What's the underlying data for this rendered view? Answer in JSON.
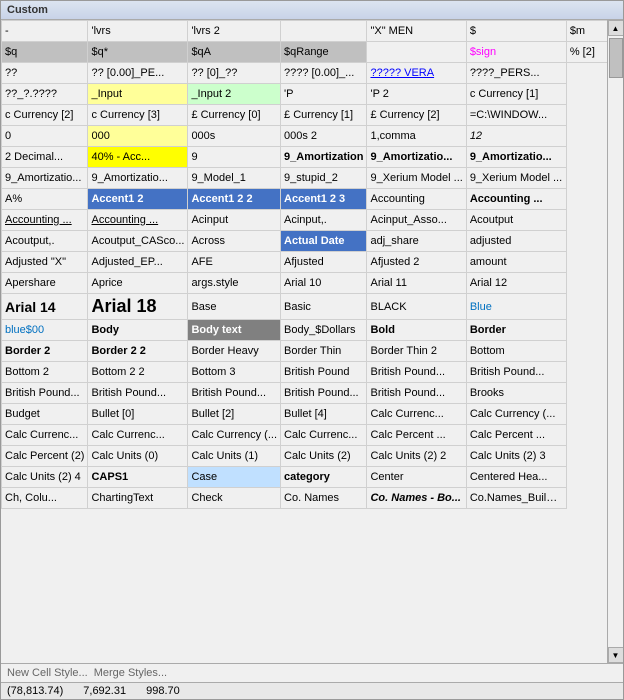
{
  "window": {
    "title": "Custom"
  },
  "buttons": {
    "new_cell_style": "New Cell Style...",
    "merge_styles": "Merge Styles..."
  },
  "status": {
    "val1": "(78,813.74)",
    "val2": "7,692.31",
    "val3": "998.70"
  },
  "grid_rows": [
    [
      {
        "text": "-",
        "style": ""
      },
      {
        "text": "'lvrs",
        "style": ""
      },
      {
        "text": "'lvrs 2",
        "style": ""
      },
      {
        "text": "",
        "style": ""
      },
      {
        "text": "\"X\" MEN",
        "style": ""
      },
      {
        "text": "$",
        "style": ""
      },
      {
        "text": "$m",
        "style": ""
      }
    ],
    [
      {
        "text": "$q",
        "style": "cell-gray"
      },
      {
        "text": "$q*",
        "style": "cell-gray"
      },
      {
        "text": "$qA",
        "style": "cell-gray"
      },
      {
        "text": "$qRange",
        "style": "cell-gray"
      },
      {
        "text": "",
        "style": ""
      },
      {
        "text": "$sign",
        "style": "cell-pink-text"
      },
      {
        "text": "% [2]",
        "style": ""
      }
    ],
    [
      {
        "text": "??",
        "style": ""
      },
      {
        "text": "?? [0.00]_PE...",
        "style": ""
      },
      {
        "text": "?? [0]_??",
        "style": ""
      },
      {
        "text": "???? [0.00]_...",
        "style": ""
      },
      {
        "text": "????? VERA",
        "style": "cell-vera"
      },
      {
        "text": "????_PERS...",
        "style": ""
      }
    ],
    [
      {
        "text": "??_?.????",
        "style": ""
      },
      {
        "text": "_Input",
        "style": "cell-input"
      },
      {
        "text": "_Input 2",
        "style": "cell-input2"
      },
      {
        "text": "'P",
        "style": ""
      },
      {
        "text": "'P 2",
        "style": ""
      },
      {
        "text": "c Currency [1]",
        "style": ""
      }
    ],
    [
      {
        "text": "c Currency [2]",
        "style": ""
      },
      {
        "text": "c Currency [3]",
        "style": ""
      },
      {
        "text": "£ Currency [0]",
        "style": ""
      },
      {
        "text": "£ Currency [1]",
        "style": ""
      },
      {
        "text": "£ Currency [2]",
        "style": ""
      },
      {
        "text": "=C:\\WINDOW...",
        "style": ""
      }
    ],
    [
      {
        "text": "0",
        "style": ""
      },
      {
        "text": "000",
        "style": "cell-yellow"
      },
      {
        "text": "000s",
        "style": ""
      },
      {
        "text": "000s 2",
        "style": ""
      },
      {
        "text": "1,comma",
        "style": ""
      },
      {
        "text": "12",
        "style": "cell-italic"
      }
    ],
    [
      {
        "text": "2 Decimal...",
        "style": ""
      },
      {
        "text": "40% - Acc...",
        "style": "cell-percent"
      },
      {
        "text": "9",
        "style": ""
      },
      {
        "text": "9_Amortization",
        "style": "cell-bold"
      },
      {
        "text": "9_Amortizatio...",
        "style": "cell-bold"
      },
      {
        "text": "9_Amortizatio...",
        "style": "cell-bold"
      }
    ],
    [
      {
        "text": "9_Amortizatio...",
        "style": ""
      },
      {
        "text": "9_Amortizatio...",
        "style": ""
      },
      {
        "text": "9_Model_1",
        "style": ""
      },
      {
        "text": "9_stupid_2",
        "style": ""
      },
      {
        "text": "9_Xerium Model ...",
        "style": ""
      },
      {
        "text": "9_Xerium Model ...",
        "style": ""
      }
    ],
    [
      {
        "text": "A%",
        "style": "cell-border-left"
      },
      {
        "text": "Accent1 2",
        "style": "cell-accent1-2"
      },
      {
        "text": "Accent1 2 2",
        "style": "cell-accent1-22"
      },
      {
        "text": "Accent1 2 3",
        "style": "cell-accent1-23"
      },
      {
        "text": "Accounting",
        "style": ""
      },
      {
        "text": "Accounting ...",
        "style": "cell-bold"
      }
    ],
    [
      {
        "text": "Accounting ...",
        "style": "cell-underline"
      },
      {
        "text": "Accounting ...",
        "style": "cell-underline"
      },
      {
        "text": "Acinput",
        "style": "cell-border-left"
      },
      {
        "text": "Acinput,.",
        "style": ""
      },
      {
        "text": "Acinput_Asso...",
        "style": ""
      },
      {
        "text": "Acoutput",
        "style": ""
      }
    ],
    [
      {
        "text": "Acoutput,.",
        "style": ""
      },
      {
        "text": "Acoutput_CASco...",
        "style": ""
      },
      {
        "text": "Across",
        "style": ""
      },
      {
        "text": "Actual Date",
        "style": "cell-actual-date"
      },
      {
        "text": "adj_share",
        "style": ""
      },
      {
        "text": "adjusted",
        "style": ""
      }
    ],
    [
      {
        "text": "Adjusted \"X\"",
        "style": ""
      },
      {
        "text": "Adjusted_EP...",
        "style": ""
      },
      {
        "text": "AFE",
        "style": ""
      },
      {
        "text": "Afjusted",
        "style": ""
      },
      {
        "text": "Afjusted 2",
        "style": ""
      },
      {
        "text": "amount",
        "style": ""
      }
    ],
    [
      {
        "text": "Apershare",
        "style": "cell-border-left"
      },
      {
        "text": "Aprice",
        "style": "cell-border-left"
      },
      {
        "text": "args.style",
        "style": ""
      },
      {
        "text": "Arial 10",
        "style": ""
      },
      {
        "text": "Arial 11",
        "style": ""
      },
      {
        "text": "Arial 12",
        "style": ""
      }
    ],
    [
      {
        "text": "Arial 14",
        "style": "cell-arial14"
      },
      {
        "text": "Arial 18",
        "style": "cell-arial18"
      },
      {
        "text": "Base",
        "style": ""
      },
      {
        "text": "Basic",
        "style": ""
      },
      {
        "text": "BLACK",
        "style": ""
      },
      {
        "text": "Blue",
        "style": "cell-blue-text"
      }
    ],
    [
      {
        "text": "blue$00",
        "style": "cell-blue-s00"
      },
      {
        "text": "Body",
        "style": "cell-bold"
      },
      {
        "text": "Body text",
        "style": "cell-body-text"
      },
      {
        "text": "Body_$Dollars",
        "style": ""
      },
      {
        "text": "Bold",
        "style": "cell-bold"
      },
      {
        "text": "Border",
        "style": "cell-bold"
      }
    ],
    [
      {
        "text": "Border 2",
        "style": "cell-bold"
      },
      {
        "text": "Border 2 2",
        "style": "cell-bold"
      },
      {
        "text": "Border Heavy",
        "style": ""
      },
      {
        "text": "Border Thin",
        "style": ""
      },
      {
        "text": "Border Thin 2",
        "style": ""
      },
      {
        "text": "Bottom",
        "style": ""
      }
    ],
    [
      {
        "text": "Bottom 2",
        "style": ""
      },
      {
        "text": "Bottom 2 2",
        "style": ""
      },
      {
        "text": "Bottom 3",
        "style": ""
      },
      {
        "text": "British Pound",
        "style": ""
      },
      {
        "text": "British Pound...",
        "style": ""
      },
      {
        "text": "British Pound...",
        "style": ""
      }
    ],
    [
      {
        "text": "British Pound...",
        "style": ""
      },
      {
        "text": "British Pound...",
        "style": ""
      },
      {
        "text": "British Pound...",
        "style": ""
      },
      {
        "text": "British Pound...",
        "style": ""
      },
      {
        "text": "British Pound...",
        "style": ""
      },
      {
        "text": "Brooks",
        "style": ""
      }
    ],
    [
      {
        "text": "Budget",
        "style": ""
      },
      {
        "text": "Bullet [0]",
        "style": ""
      },
      {
        "text": "Bullet [2]",
        "style": ""
      },
      {
        "text": "Bullet [4]",
        "style": ""
      },
      {
        "text": "Calc Currenc...",
        "style": ""
      },
      {
        "text": "Calc Currency (...",
        "style": ""
      }
    ],
    [
      {
        "text": "Calc Currenc...",
        "style": ""
      },
      {
        "text": "Calc Currenc...",
        "style": ""
      },
      {
        "text": "Calc Currency (...",
        "style": ""
      },
      {
        "text": "Calc Currenc...",
        "style": ""
      },
      {
        "text": "Calc Percent ...",
        "style": ""
      },
      {
        "text": "Calc Percent ...",
        "style": ""
      }
    ],
    [
      {
        "text": "Calc Percent (2)",
        "style": ""
      },
      {
        "text": "Calc Units (0)",
        "style": ""
      },
      {
        "text": "Calc Units (1)",
        "style": ""
      },
      {
        "text": "Calc Units (2)",
        "style": ""
      },
      {
        "text": "Calc Units (2) 2",
        "style": ""
      },
      {
        "text": "Calc Units (2) 3",
        "style": ""
      }
    ],
    [
      {
        "text": "Calc Units (2) 4",
        "style": ""
      },
      {
        "text": "CAPS1",
        "style": "cell-bold"
      },
      {
        "text": "Case",
        "style": "cell-case"
      },
      {
        "text": "category",
        "style": "cell-bold"
      },
      {
        "text": "Center",
        "style": ""
      },
      {
        "text": "Centered Hea...",
        "style": ""
      }
    ],
    [
      {
        "text": "Ch, Colu...",
        "style": ""
      },
      {
        "text": "ChartingText",
        "style": ""
      },
      {
        "text": "Check",
        "style": ""
      },
      {
        "text": "Co. Names",
        "style": ""
      },
      {
        "text": "Co. Names - Bo...",
        "style": "cell-co-names-bold"
      },
      {
        "text": "Co.Names_Buildup...",
        "style": ""
      }
    ]
  ]
}
